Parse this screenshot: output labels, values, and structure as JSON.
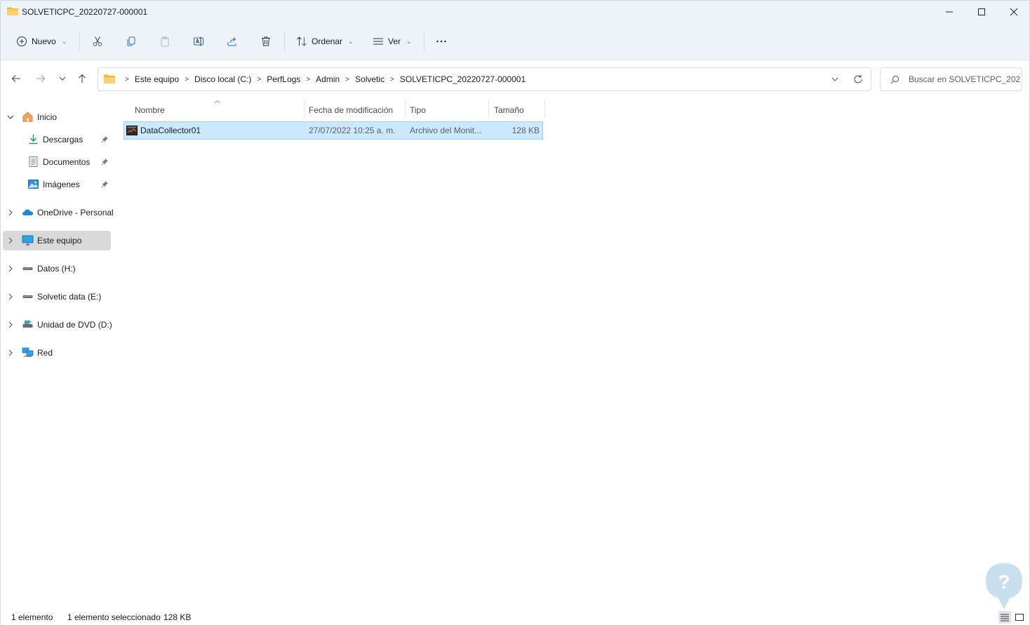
{
  "window": {
    "title": "SOLVETICPC_20220727-000001",
    "controls": {
      "minimize": "minimize-icon",
      "maximize": "maximize-icon",
      "close": "close-icon"
    }
  },
  "toolbar": {
    "new_label": "Nuevo",
    "sort_label": "Ordenar",
    "view_label": "Ver",
    "icons": [
      "cut-icon",
      "copy-icon",
      "paste-icon",
      "rename-icon",
      "share-icon",
      "delete-icon",
      "more-icon"
    ]
  },
  "address": {
    "crumbs": [
      "Este equipo",
      "Disco local (C:)",
      "PerfLogs",
      "Admin",
      "Solvetic",
      "SOLVETICPC_20220727-000001"
    ]
  },
  "search": {
    "placeholder": "Buscar en SOLVETICPC_2022..."
  },
  "sidebar": {
    "items": [
      {
        "label": "Inicio",
        "icon": "home-icon",
        "expanded": true
      },
      {
        "label": "Descargas",
        "icon": "download-icon",
        "pinned": true
      },
      {
        "label": "Documentos",
        "icon": "document-icon",
        "pinned": true
      },
      {
        "label": "Imágenes",
        "icon": "image-icon",
        "pinned": true
      },
      {
        "label": "OneDrive - Personal",
        "icon": "cloud-icon"
      },
      {
        "label": "Este equipo",
        "icon": "computer-icon",
        "selected": true
      },
      {
        "label": "Datos (H:)",
        "icon": "drive-icon"
      },
      {
        "label": "Solvetic data (E:)",
        "icon": "drive-icon"
      },
      {
        "label": "Unidad de DVD (D:)",
        "icon": "dvd-icon"
      },
      {
        "label": "Red",
        "icon": "network-icon"
      }
    ]
  },
  "table": {
    "columns": [
      "Nombre",
      "Fecha de modificación",
      "Tipo",
      "Tamaño"
    ],
    "rows": [
      {
        "name": "DataCollector01",
        "modified": "27/07/2022 10:25 a. m.",
        "type": "Archivo del Monit...",
        "size": "128 KB",
        "selected": true
      }
    ]
  },
  "status": {
    "count": "1 elemento",
    "selection": "1 elemento seleccionado",
    "selection_size": "128 KB"
  },
  "colors": {
    "accent": "#0067c0",
    "selection_bg": "#cce8ff",
    "toolbar_bg": "#eef3f9"
  }
}
